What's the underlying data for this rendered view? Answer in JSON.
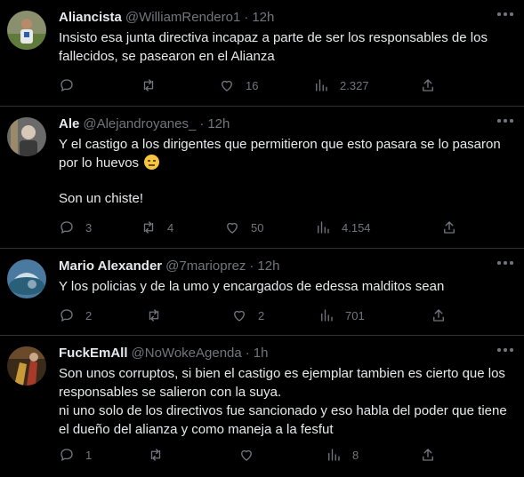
{
  "tweets": [
    {
      "name": "Aliancista",
      "handle": "@WilliamRendero1",
      "time": "12h",
      "lines": [
        "Insisto esa junta directiva incapaz a parte de ser los responsables de los fallecidos, se pasearon en el Alianza"
      ],
      "replies": "",
      "retweets": "",
      "likes": "16",
      "views": "2.327"
    },
    {
      "name": "Ale",
      "handle": "@Alejandroyanes_",
      "time": "12h",
      "lines": [
        "Y el castigo a los dirigentes que permitieron que esto pasara se lo pasaron por lo huevos",
        "Son un chiste!"
      ],
      "emoji": "unamused-face",
      "replies": "3",
      "retweets": "4",
      "likes": "50",
      "views": "4.154"
    },
    {
      "name": "Mario Alexander",
      "handle": "@7marioprez",
      "time": "12h",
      "lines": [
        "Y los policias y de la umo y encargados de edessa malditos sean"
      ],
      "replies": "2",
      "retweets": "",
      "likes": "2",
      "views": "701"
    },
    {
      "name": "FuckEmAll",
      "handle": "@NoWokeAgenda",
      "time": "1h",
      "lines": [
        "Son unos corruptos, si bien el castigo es ejemplar tambien es cierto que los responsables se salieron con la suya.",
        "ni uno solo de los directivos fue sancionado y eso habla del poder que tiene el dueño del alianza y como maneja a la fesfut"
      ],
      "replies": "1",
      "retweets": "",
      "likes": "",
      "views": "8"
    }
  ],
  "colors": {
    "background": "#000000",
    "text": "#e7e9ea",
    "muted": "#71767b",
    "divider": "#2f3336"
  },
  "icons": [
    "reply-icon",
    "retweet-icon",
    "like-icon",
    "views-icon",
    "share-icon",
    "more-icon"
  ]
}
